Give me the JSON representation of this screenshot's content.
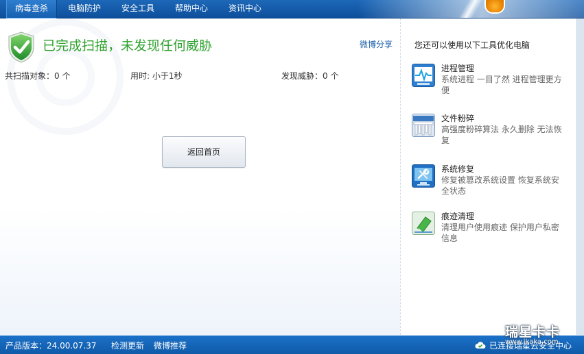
{
  "nav": {
    "tabs": [
      {
        "label": "病毒查杀"
      },
      {
        "label": "电脑防护"
      },
      {
        "label": "安全工具"
      },
      {
        "label": "帮助中心"
      },
      {
        "label": "资讯中心"
      }
    ],
    "active_index": 0
  },
  "scan": {
    "title": "已完成扫描，未发现任何威胁",
    "share_label": "微博分享",
    "stats": {
      "scanned": "共扫描对象：0 个",
      "time": "用时: 小于1秒",
      "threats": "发现威胁：0 个"
    },
    "return_button": "返回首页"
  },
  "side": {
    "title": "您还可以使用以下工具优化电脑",
    "tools": [
      {
        "name": "进程管理",
        "desc": "系统进程 一目了然 进程管理更方便",
        "icon": "process-monitor-icon"
      },
      {
        "name": "文件粉碎",
        "desc": "高强度粉碎算法 永久删除 无法恢复",
        "icon": "file-shredder-icon"
      },
      {
        "name": "系统修复",
        "desc": "修复被篡改系统设置 恢复系统安全状态",
        "icon": "system-repair-icon"
      },
      {
        "name": "痕迹清理",
        "desc": "清理用户使用痕迹 保护用户私密信息",
        "icon": "eraser-icon"
      }
    ]
  },
  "status": {
    "version": "产品版本：24.00.07.37",
    "check_update": "检测更新",
    "weibo": "微博推荐",
    "cloud": "已连接瑞星云安全中心"
  },
  "watermark": {
    "text": "瑞星卡卡",
    "url": "www.ikaka.com"
  },
  "colors": {
    "nav_bg": "#1766b6",
    "success_green": "#2ea12e",
    "link_blue": "#1b5fa8",
    "statusbar_bg": "#1566bb"
  }
}
